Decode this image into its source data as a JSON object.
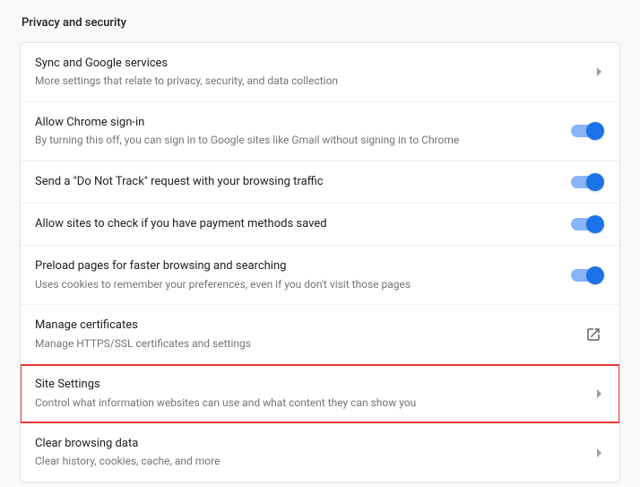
{
  "section_title": "Privacy and security",
  "rows": [
    {
      "title": "Sync and Google services",
      "sub": "More settings that relate to privacy, security, and data collection"
    },
    {
      "title": "Allow Chrome sign-in",
      "sub": "By turning this off, you can sign in to Google sites like Gmail without signing in to Chrome"
    },
    {
      "title": "Send a \"Do Not Track\" request with your browsing traffic"
    },
    {
      "title": "Allow sites to check if you have payment methods saved"
    },
    {
      "title": "Preload pages for faster browsing and searching",
      "sub": "Uses cookies to remember your preferences, even if you don't visit those pages"
    },
    {
      "title": "Manage certificates",
      "sub": "Manage HTTPS/SSL certificates and settings"
    },
    {
      "title": "Site Settings",
      "sub": "Control what information websites can use and what content they can show you"
    },
    {
      "title": "Clear browsing data",
      "sub": "Clear history, cookies, cache, and more"
    }
  ]
}
